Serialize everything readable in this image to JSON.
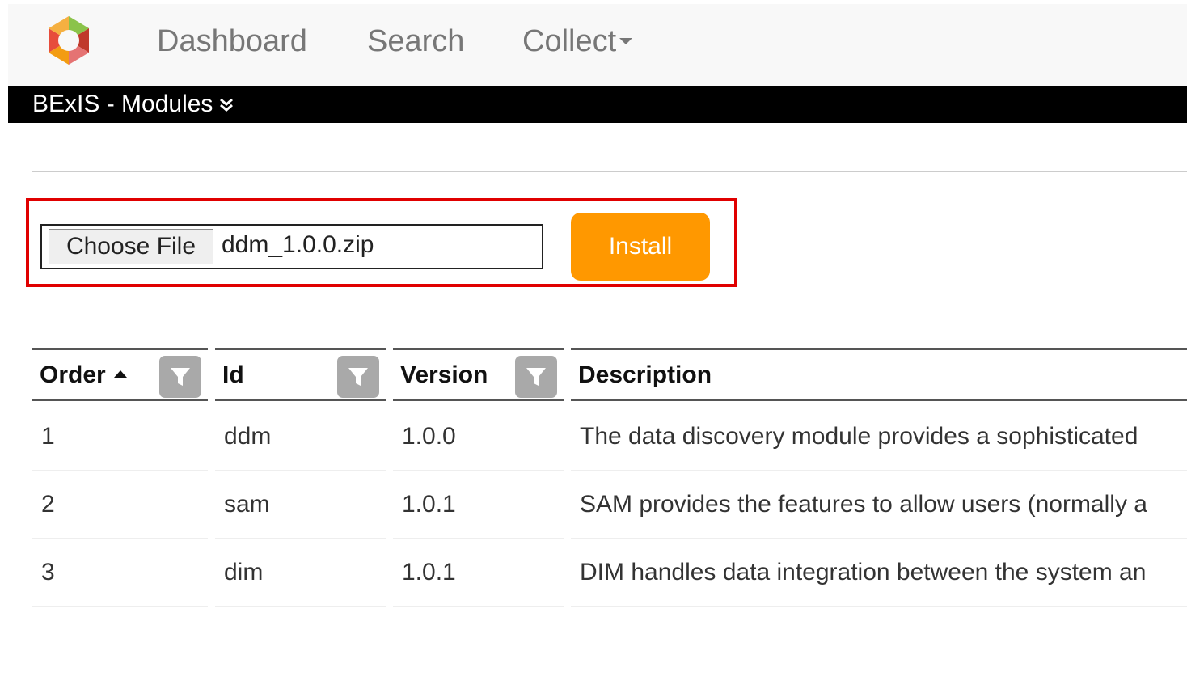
{
  "nav": {
    "items": [
      "Dashboard",
      "Search",
      "Collect"
    ]
  },
  "subbar": {
    "title": "BExIS - Modules"
  },
  "upload": {
    "choose_label": "Choose File",
    "file_name": "ddm_1.0.0.zip",
    "install_label": "Install"
  },
  "table": {
    "headers": [
      "Order",
      "Id",
      "Version",
      "Description"
    ],
    "rows": [
      {
        "order": "1",
        "id": "ddm",
        "version": "1.0.0",
        "description": "The data discovery module provides a sophisticated"
      },
      {
        "order": "2",
        "id": "sam",
        "version": "1.0.1",
        "description": "SAM provides the features to allow users (normally a"
      },
      {
        "order": "3",
        "id": "dim",
        "version": "1.0.1",
        "description": "DIM handles data integration between the system an"
      }
    ]
  },
  "colors": {
    "accent": "#ff9800",
    "highlight_border": "#e00000",
    "subbar_bg": "#000000",
    "filter_button": "#a9a9a9"
  },
  "icons": {
    "logo": "bexis-logo-icon",
    "subbar_chevron": "double-chevron-down-icon",
    "sort": "sort-ascending-icon",
    "filter": "filter-icon"
  }
}
